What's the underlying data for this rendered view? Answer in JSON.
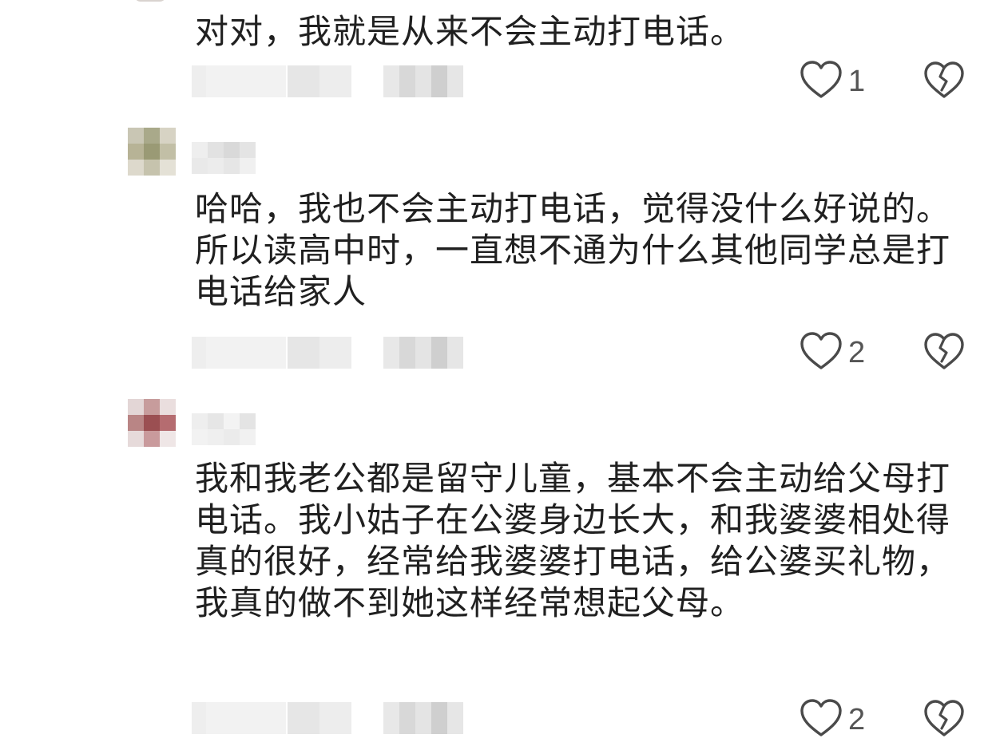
{
  "comments": [
    {
      "text": "对对，我就是从来不会主动打电话。",
      "like_count": "1"
    },
    {
      "text": "哈哈，我也不会主动打电话，觉得没什么好说的。所以读高中时，一直想不通为什么其他同学总是打电话给家人",
      "like_count": "2"
    },
    {
      "text": "我和我老公都是留守儿童，基本不会主动给父母打电话。我小姑子在公婆身边长大，和我婆婆相处得真的很好，经常给我婆婆打电话，给公婆买礼物，我真的做不到她这样经常想起父母。",
      "like_count": "2"
    }
  ],
  "icons": {
    "like": "heart-outline-icon",
    "dislike": "broken-heart-icon"
  },
  "colors": {
    "text": "#202020",
    "icon": "#4a4a4a",
    "count": "#555555",
    "blur_light": "#ececec",
    "blur_mid": "#dcdcdc"
  }
}
